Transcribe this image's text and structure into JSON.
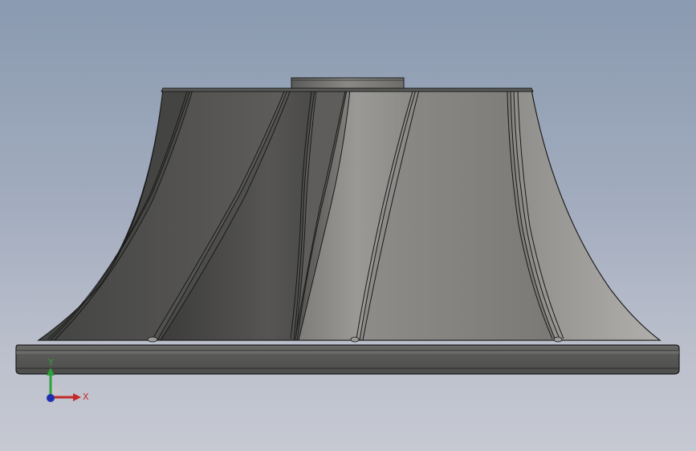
{
  "viewport": {
    "background_top": "#8a9ab0",
    "background_bottom": "#c6c9d2"
  },
  "model": {
    "type": "impeller",
    "color_dark": "#4a4a48",
    "color_mid": "#7a7976",
    "color_light": "#a9a8a5",
    "edge_color": "#1a1a1a"
  },
  "triad": {
    "y_label": "Y",
    "x_label": "X",
    "y_color": "#2fa03a",
    "x_color": "#c42a2a",
    "z_color": "#1f2fb0"
  }
}
